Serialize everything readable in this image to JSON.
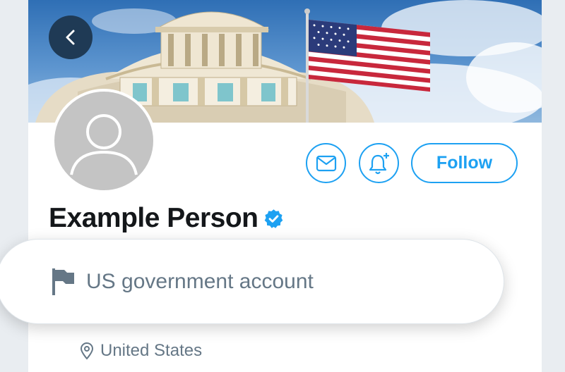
{
  "profile": {
    "name": "Example Person",
    "verified": true,
    "location": "United States"
  },
  "label": {
    "text": "US government account",
    "icon": "flag-icon"
  },
  "actions": {
    "follow_label": "Follow",
    "message_icon": "envelope-icon",
    "notify_icon": "bell-plus-icon",
    "back_icon": "chevron-left-icon"
  },
  "colors": {
    "accent": "#1da1f2",
    "name_text": "#14171a",
    "secondary_text": "#657786",
    "back_button_bg": "#1f3a55"
  }
}
